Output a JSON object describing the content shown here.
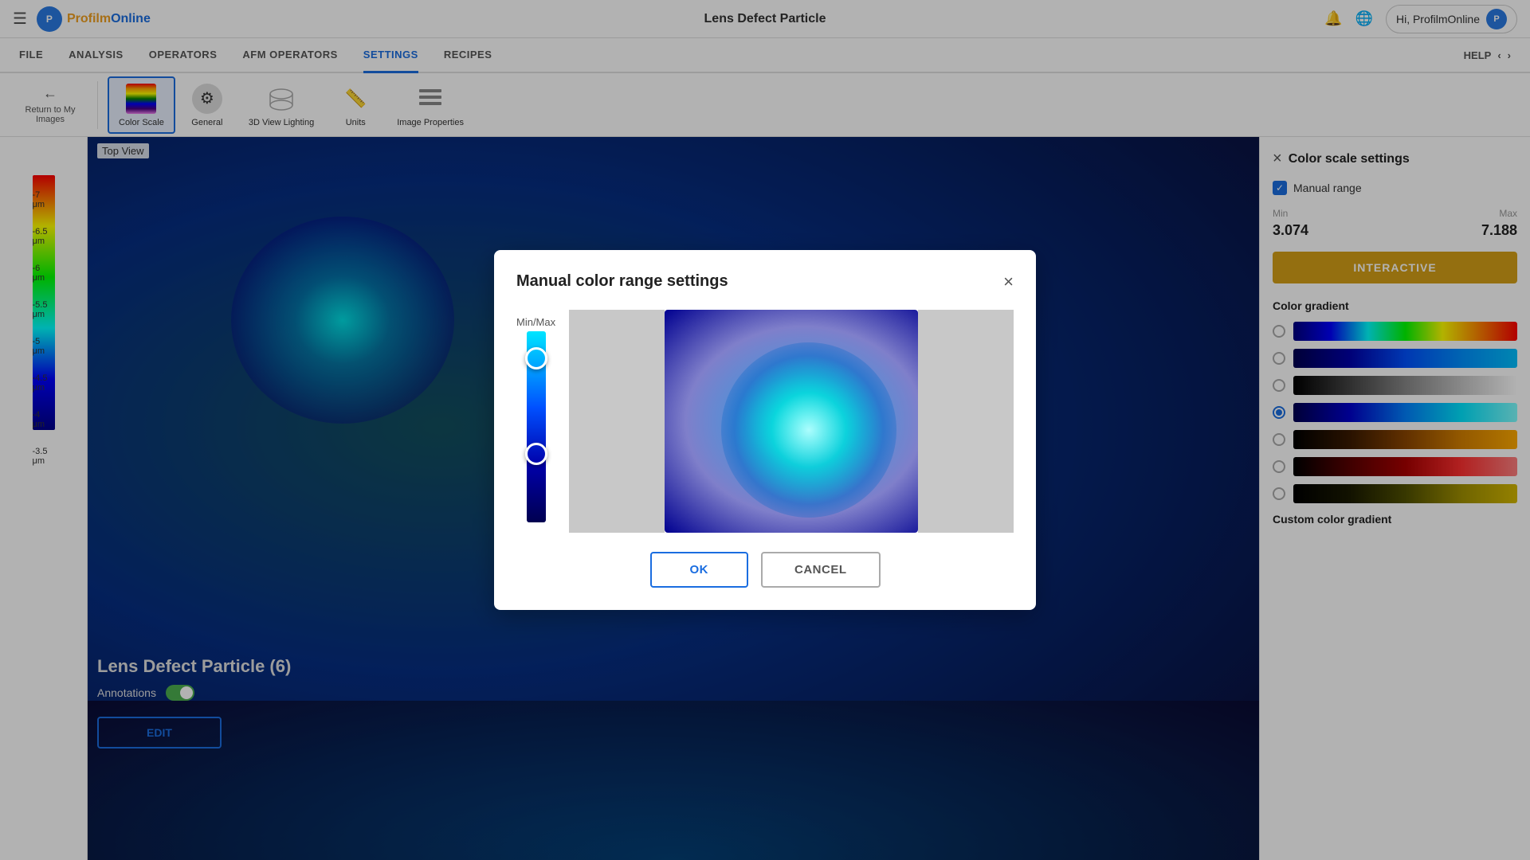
{
  "app": {
    "title": "Lens Defect Particle",
    "logo_text": "ProfilmOnline",
    "hamburger": "☰",
    "bell_icon": "🔔",
    "globe_icon": "🌐",
    "greeting": "Hi, ProfilmOnline",
    "help_label": "HELP"
  },
  "nav": {
    "items": [
      {
        "label": "FILE",
        "active": false
      },
      {
        "label": "ANALYSIS",
        "active": false
      },
      {
        "label": "OPERATORS",
        "active": false
      },
      {
        "label": "AFM OPERATORS",
        "active": false
      },
      {
        "label": "SETTINGS",
        "active": true
      },
      {
        "label": "RECIPES",
        "active": false
      }
    ]
  },
  "toolbar": {
    "back_label": "Return to My Images",
    "items": [
      {
        "id": "color-scale",
        "label": "Color Scale",
        "active": true
      },
      {
        "id": "general",
        "label": "General",
        "active": false
      },
      {
        "id": "3d-view",
        "label": "3D View Lighting",
        "active": false
      },
      {
        "id": "units",
        "label": "Units",
        "active": false
      },
      {
        "id": "image-properties",
        "label": "Image Properties",
        "active": false
      }
    ]
  },
  "canvas": {
    "top_view_label": "Top View",
    "image_title": "Lens Defect Particle (6)",
    "annotations_label": "Annotations",
    "edit_button": "EDIT"
  },
  "scale": {
    "labels": [
      "7 μm",
      "6.5 μm",
      "6 μm",
      "5.5 μm",
      "5 μm",
      "4.5 μm",
      "4 μm",
      "3.5 μm"
    ]
  },
  "right_panel": {
    "title": "Color scale settings",
    "close_icon": "×",
    "manual_range_label": "Manual range",
    "min_label": "Min",
    "max_label": "Max",
    "min_value": "3.074",
    "max_value": "7.188",
    "interactive_button": "INTERACTIVE",
    "color_gradient_title": "Color gradient",
    "gradients": [
      {
        "id": "g1",
        "selected": false
      },
      {
        "id": "g2",
        "selected": false
      },
      {
        "id": "g3",
        "selected": false
      },
      {
        "id": "g4",
        "selected": true
      },
      {
        "id": "g5",
        "selected": false
      },
      {
        "id": "g6",
        "selected": false
      },
      {
        "id": "g7",
        "selected": false
      }
    ],
    "custom_label": "Custom color gradient"
  },
  "modal": {
    "title": "Manual color range settings",
    "close_icon": "×",
    "minmax_label": "Min/Max",
    "ok_button": "OK",
    "cancel_button": "CANCEL"
  }
}
